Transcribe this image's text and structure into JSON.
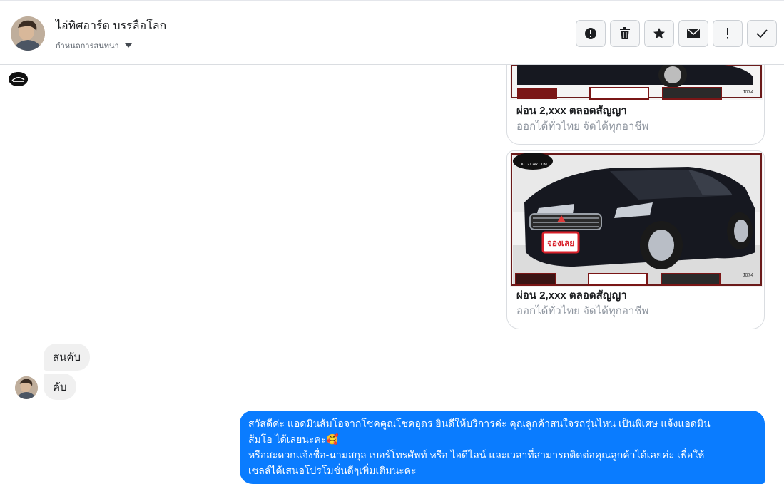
{
  "header": {
    "contact_name": "ไอ่ทิศอาร์ต บรรลือโลก",
    "conversation_settings": "กำหนดการสนทนา"
  },
  "toolbar": {
    "buttons": [
      {
        "icon": "alert-circle-icon"
      },
      {
        "icon": "trash-icon"
      },
      {
        "icon": "star-icon"
      },
      {
        "icon": "envelope-icon"
      },
      {
        "icon": "exclamation-icon"
      },
      {
        "icon": "checkmark-icon"
      }
    ]
  },
  "cards": [
    {
      "title": "ผ่อน 2,xxx ตลอดสัญญา",
      "subtitle": "ออกได้ทั่วไทย จัดได้ทุกอาชีพ",
      "code": "J074"
    },
    {
      "title": "ผ่อน 2,xxx ตลอดสัญญา",
      "subtitle": "ออกได้ทั่วไทย จัดได้ทุกอาชีพ",
      "code": "J074",
      "badge": "จองเลย",
      "watermark": "CKC 2 CAR.COM"
    }
  ],
  "incoming": [
    {
      "text": "สนคับ"
    },
    {
      "text": "คับ"
    }
  ],
  "outgoing": {
    "lines": [
      "สวัสดีค่ะ แอดมินส้มโอจากโชคคูณโชคอุดร ยินดีให้บริการค่ะ   คุณลูกค้าสนใจรถรุ่นไหน เป็นพิเศษ แจ้งแอดมิน",
      "ส้มโอ ได้เลยนะคะ🥰",
      "หรือสะดวกแจ้งชื่อ-นามสกุล เบอร์โทรศัพท์ หรือ ไอดีไลน์ และเวลาที่สามารถติดต่อคุณลูกค้าได้เลยค่ะ เพื่อให้",
      "เซลล์ได้เสนอโปรโมชั่นดีๆเพิ่มเติมนะคะ"
    ]
  },
  "colors": {
    "outgoing_bubble": "#0a7cff",
    "incoming_bubble": "#f0f0f0",
    "car_body": "#161820",
    "badge_red": "#d8202a"
  }
}
